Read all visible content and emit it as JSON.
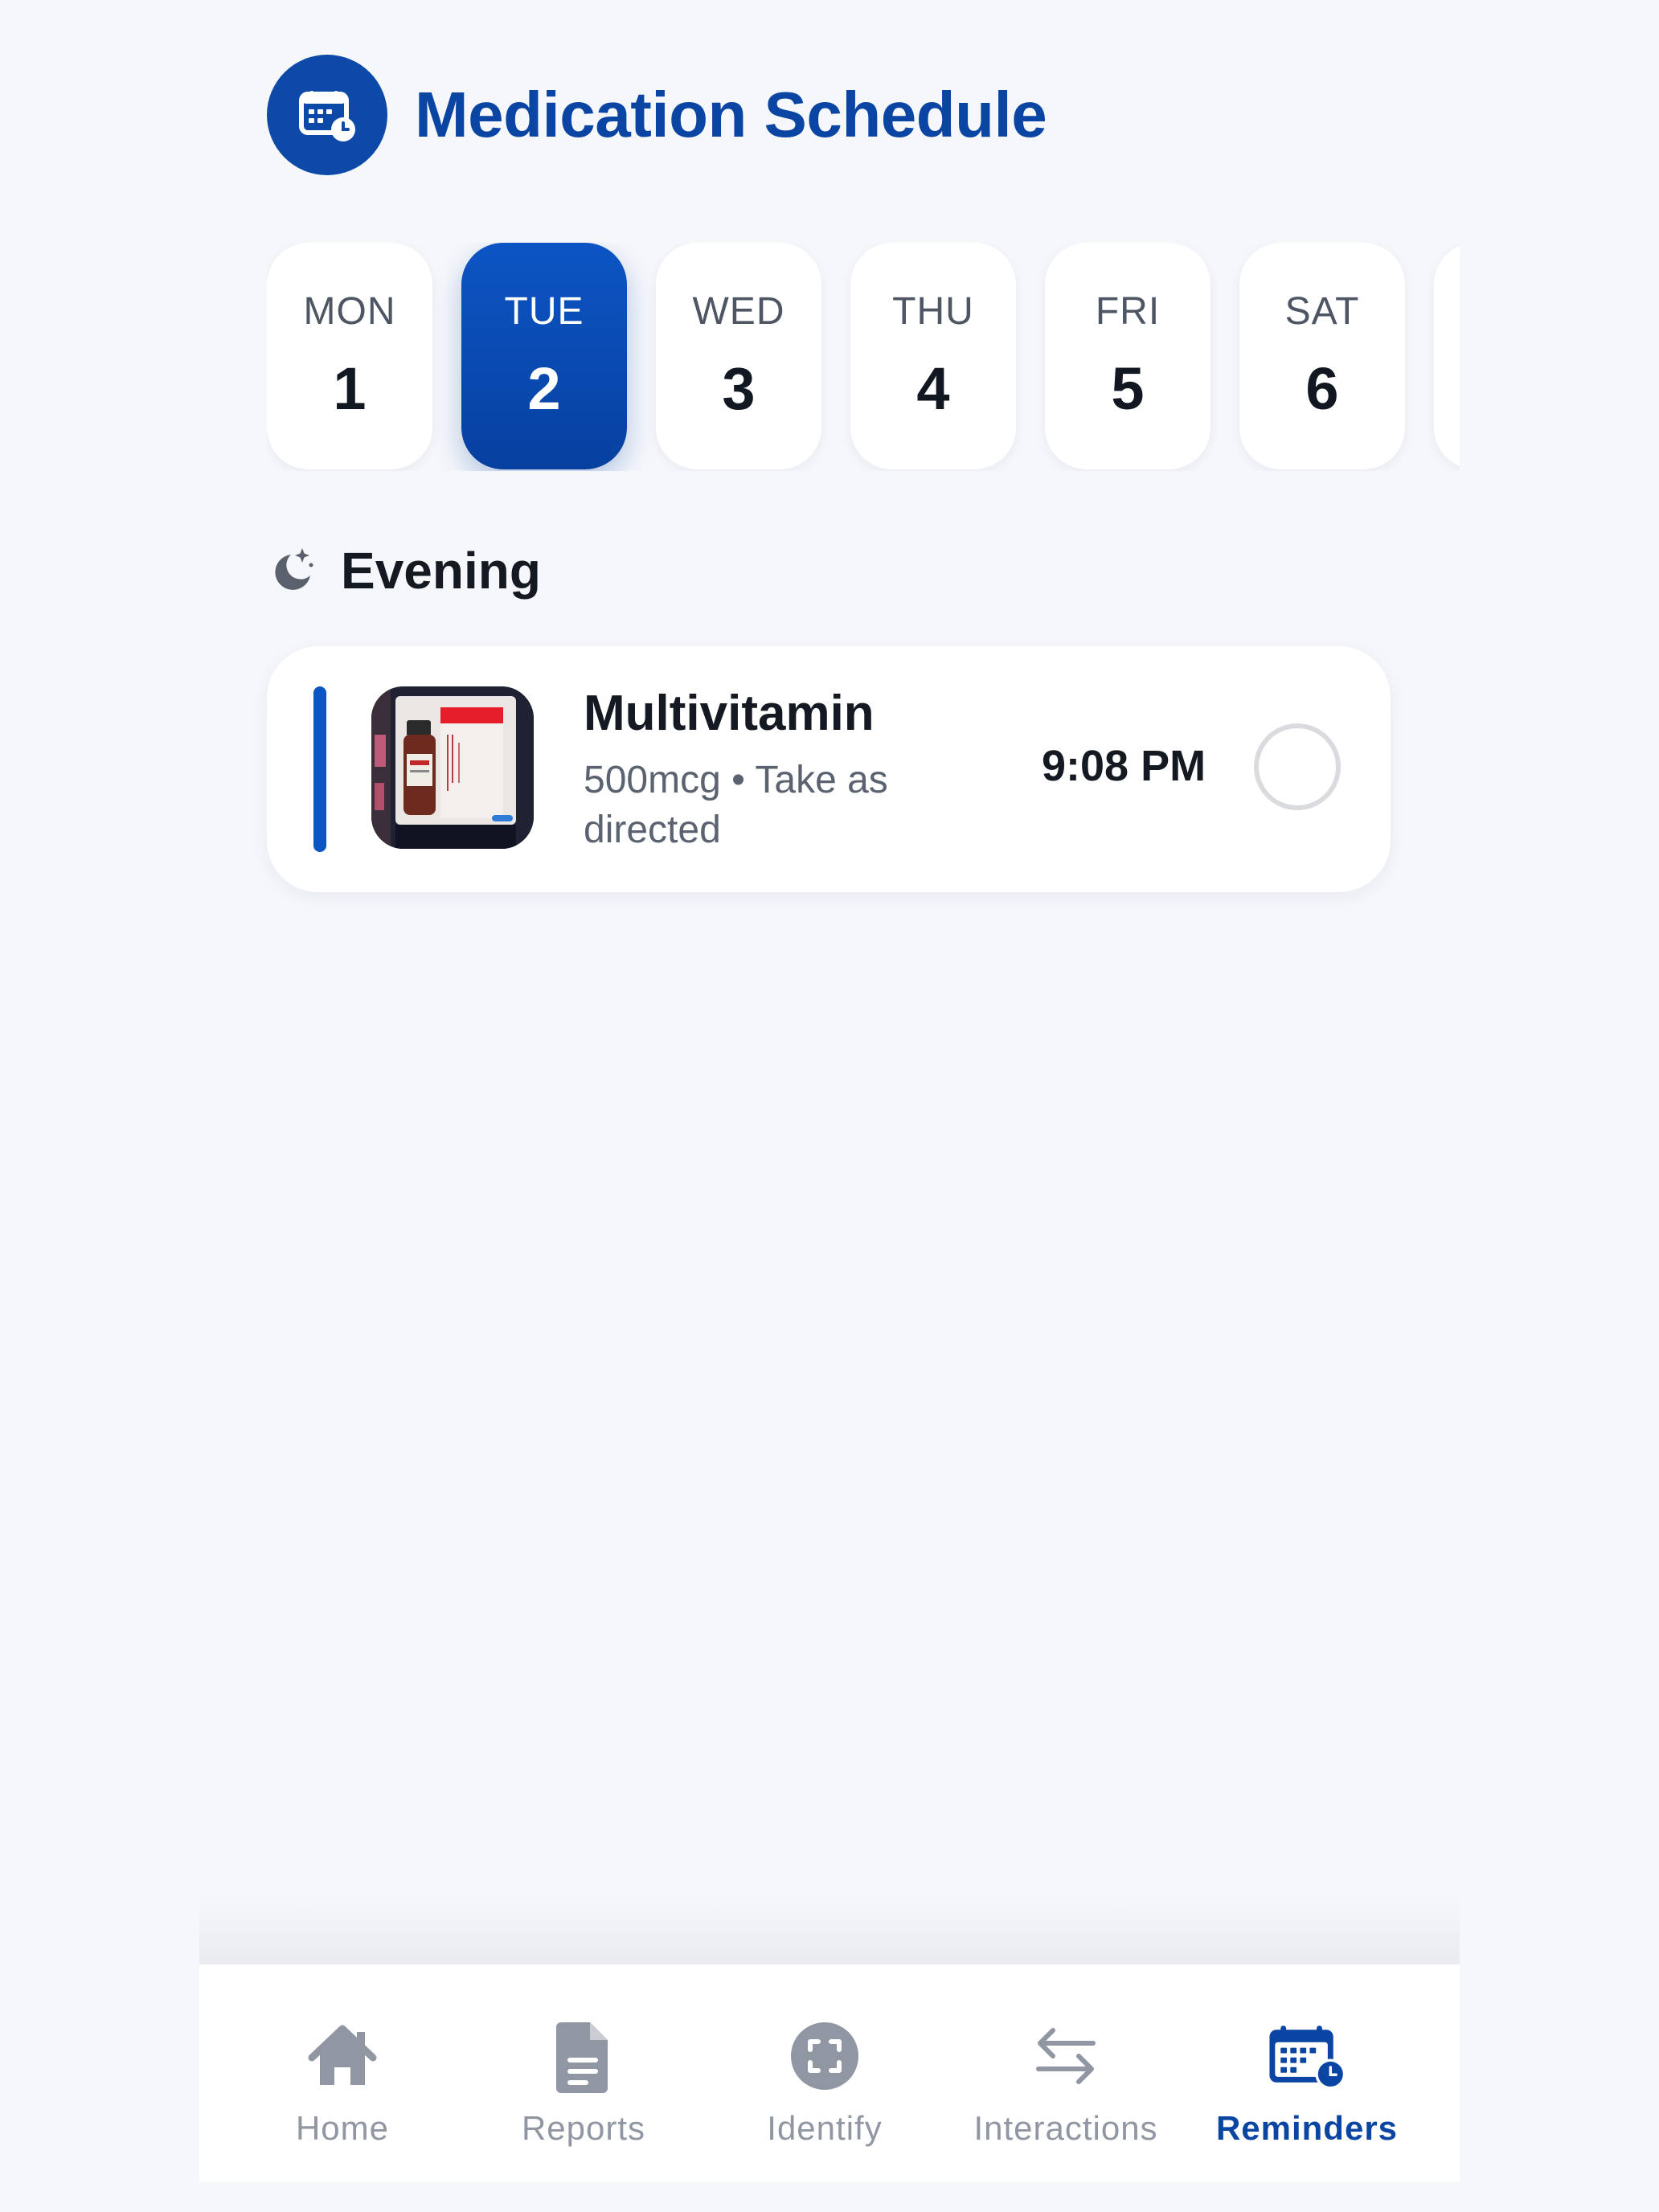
{
  "header": {
    "title": "Medication Schedule",
    "icon": "calendar-clock-icon"
  },
  "days": [
    {
      "label": "MON",
      "num": "1"
    },
    {
      "label": "TUE",
      "num": "2",
      "selected": true
    },
    {
      "label": "WED",
      "num": "3"
    },
    {
      "label": "THU",
      "num": "4"
    },
    {
      "label": "FRI",
      "num": "5"
    },
    {
      "label": "SAT",
      "num": "6"
    }
  ],
  "section": {
    "title": "Evening",
    "icon": "moon-sparkle-icon"
  },
  "medication": {
    "name": "Multivitamin",
    "detail": "500mcg • Take as directed",
    "time": "9:08 PM",
    "taken": false
  },
  "tabs": [
    {
      "label": "Home",
      "icon": "home-icon"
    },
    {
      "label": "Reports",
      "icon": "document-icon"
    },
    {
      "label": "Identify",
      "icon": "scan-icon"
    },
    {
      "label": "Interactions",
      "icon": "swap-arrows-icon"
    },
    {
      "label": "Reminders",
      "icon": "calendar-clock-icon",
      "active": true
    }
  ],
  "colors": {
    "accent": "#0b45a3",
    "background": "#f5f7fb",
    "tab_inactive": "#9096a2",
    "check_border": "#d9dbdf"
  }
}
